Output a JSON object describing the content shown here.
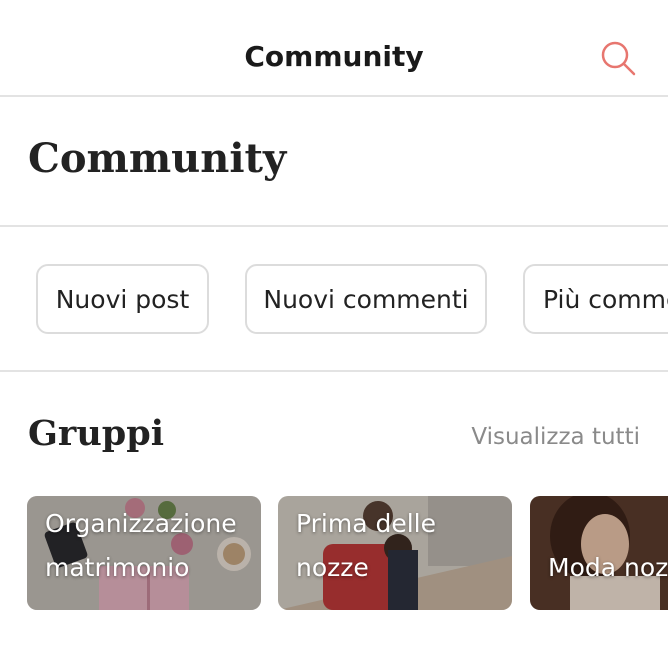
{
  "header": {
    "title": "Community",
    "search_icon": "search-icon",
    "accent_color": "#e7766f"
  },
  "page": {
    "title": "Community"
  },
  "filters": [
    {
      "label": "Nuovi post"
    },
    {
      "label": "Nuovi commenti"
    },
    {
      "label": "Più comme"
    }
  ],
  "groups": {
    "title": "Gruppi",
    "view_all": "Visualizza tutti",
    "cards": [
      {
        "label": "Organizzazione\nmatrimonio"
      },
      {
        "label": "Prima delle\nnozze"
      },
      {
        "label": "Moda noz"
      }
    ]
  }
}
